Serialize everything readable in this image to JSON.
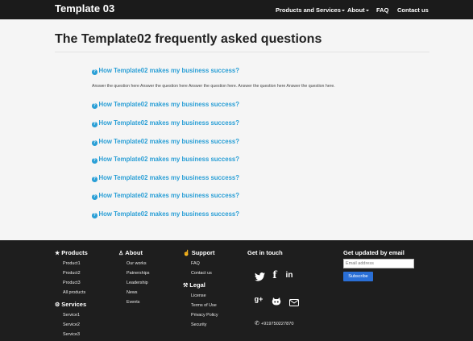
{
  "navbar": {
    "brand": "Template 03",
    "links": [
      "Products and Services",
      "About",
      "FAQ",
      "Contact us"
    ]
  },
  "main": {
    "title": "The Template02 frequently asked questions",
    "question": "How Template02 makes my business success?",
    "answer": "Answer the question here Answer the question here Answer the question here. Answer the question here Answer the question here."
  },
  "footer": {
    "products": {
      "heading": "Products",
      "items": [
        "Product1",
        "Product2",
        "Product3",
        "All products"
      ]
    },
    "services": {
      "heading": "Services",
      "items": [
        "Service1",
        "Service2",
        "Service3"
      ]
    },
    "about": {
      "heading": "About",
      "items": [
        "Our works",
        "Patnerships",
        "Leadership",
        "News",
        "Events"
      ]
    },
    "support": {
      "heading": "Support",
      "items": [
        "FAQ",
        "Contact us"
      ]
    },
    "legal": {
      "heading": "Legal",
      "items": [
        "License",
        "Terms of Use",
        "Privacy Policy",
        "Security"
      ]
    },
    "touch": {
      "heading": "Get in touch",
      "phone": "+919750227870"
    },
    "newsletter": {
      "heading": "Get updated by email",
      "placeholder": "Email address",
      "button": "Subscribe"
    }
  },
  "icons": [
    "star-icon",
    "cogs-icon",
    "user-icon",
    "thumbs-up-icon",
    "gavel-icon",
    "twitter-icon",
    "facebook-icon",
    "linkedin-icon",
    "google-plus-icon",
    "github-icon",
    "envelope-icon",
    "phone-icon",
    "question-circle-icon"
  ],
  "colors": {
    "accent": "#2a9fd6",
    "navbar": "#1b1b1b",
    "footer": "#1e1e1e",
    "button": "#2a6fd6"
  }
}
